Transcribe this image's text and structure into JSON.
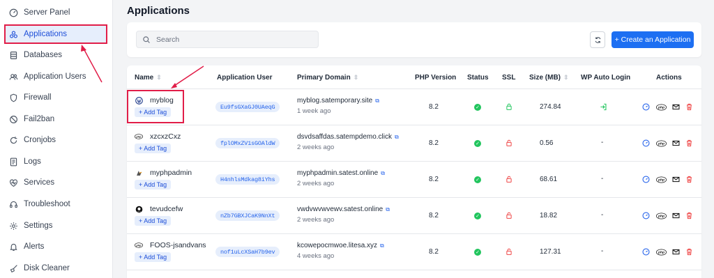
{
  "sidebar": {
    "items": [
      {
        "label": "Server Panel",
        "icon": "gauge-icon"
      },
      {
        "label": "Applications",
        "icon": "apps-icon"
      },
      {
        "label": "Databases",
        "icon": "database-icon"
      },
      {
        "label": "Application Users",
        "icon": "users-icon"
      },
      {
        "label": "Firewall",
        "icon": "shield-icon"
      },
      {
        "label": "Fail2ban",
        "icon": "ban-icon"
      },
      {
        "label": "Cronjobs",
        "icon": "cron-icon"
      },
      {
        "label": "Logs",
        "icon": "file-icon"
      },
      {
        "label": "Services",
        "icon": "heart-pulse-icon"
      },
      {
        "label": "Troubleshoot",
        "icon": "headset-icon"
      },
      {
        "label": "Settings",
        "icon": "gear-icon"
      },
      {
        "label": "Alerts",
        "icon": "bell-icon"
      },
      {
        "label": "Disk Cleaner",
        "icon": "broom-icon"
      }
    ]
  },
  "page": {
    "title": "Applications",
    "search_placeholder": "Search",
    "create_label": "+ Create an Application"
  },
  "table": {
    "headers": {
      "name": "Name",
      "user": "Application User",
      "domain": "Primary Domain",
      "php": "PHP Version",
      "status": "Status",
      "ssl": "SSL",
      "size": "Size (MB)",
      "wp_login": "WP Auto Login",
      "actions": "Actions"
    },
    "add_tag_label": "+ Add Tag",
    "rows": [
      {
        "name": "myblog",
        "icon": "wordpress-icon",
        "user": "Eu9fsGXaGJ0UAeqG",
        "domain": "myblog.satemporary.site",
        "age": "1 week ago",
        "php": "8.2",
        "size": "274.84",
        "wp_login": "login-icon",
        "ssl_color": "#22c55e"
      },
      {
        "name": "xzcxzCxz",
        "icon": "php-icon",
        "user": "fplOMxZV1sGOAldW",
        "domain": "dsvdsaffdas.satempdemo.click",
        "age": "2 weeks ago",
        "php": "8.2",
        "size": "0.56",
        "wp_login": "-",
        "ssl_color": "#ef4444"
      },
      {
        "name": "myphpadmin",
        "icon": "phpmyadmin-icon",
        "user": "H4nhlsMdkag8iYhs",
        "domain": "myphpadmin.satest.online",
        "age": "2 weeks ago",
        "php": "8.2",
        "size": "68.61",
        "wp_login": "-",
        "ssl_color": "#ef4444"
      },
      {
        "name": "tevudcefw",
        "icon": "github-icon",
        "user": "nZb7GBXJCaK9NnXt",
        "domain": "vwdvwvwvewv.satest.online",
        "age": "2 weeks ago",
        "php": "8.2",
        "size": "18.82",
        "wp_login": "-",
        "ssl_color": "#ef4444"
      },
      {
        "name": "FOOS-jsandvans",
        "icon": "php-icon",
        "user": "nof1uLcXSaH7b9ev",
        "domain": "kcowepocmwoe.litesa.xyz",
        "age": "4 weeks ago",
        "php": "8.2",
        "size": "127.31",
        "wp_login": "-",
        "ssl_color": "#ef4444"
      }
    ]
  }
}
